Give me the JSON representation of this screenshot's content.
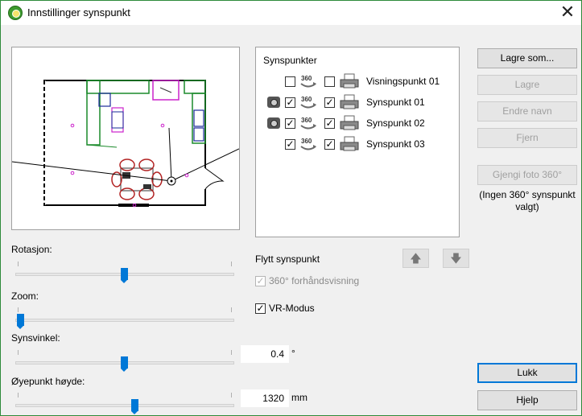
{
  "window": {
    "title": "Innstillinger synspunkt"
  },
  "viewpoints": {
    "header": "Synspunkter",
    "items": [
      {
        "label": "Visningspunkt 01",
        "camera": false,
        "check360": false,
        "checkVisible": false
      },
      {
        "label": "Synspunkt 01",
        "camera": true,
        "check360": true,
        "checkVisible": true
      },
      {
        "label": "Synspunkt 02",
        "camera": true,
        "check360": true,
        "checkVisible": true
      },
      {
        "label": "Synspunkt 03",
        "camera": false,
        "check360": true,
        "checkVisible": true
      }
    ]
  },
  "buttons": {
    "save_as": "Lagre som...",
    "save": "Lagre",
    "rename": "Endre navn",
    "remove": "Fjern",
    "render360": "Gjengi foto 360°",
    "close": "Lukk",
    "help": "Hjelp"
  },
  "render_note": "(Ingen 360° synspunkt valgt)",
  "move": {
    "label": "Flytt synspunkt",
    "preview360": "360° forhåndsvisning",
    "preview360_checked": true,
    "vr_mode": "VR-Modus",
    "vr_mode_checked": true
  },
  "sliders": {
    "rotation": {
      "label": "Rotasjon:",
      "level": 0.5
    },
    "zoom": {
      "label": "Zoom:",
      "level": 0.0
    },
    "view_angle": {
      "label": "Synsvinkel:",
      "level": 0.5,
      "value": "0.4",
      "unit": "°"
    },
    "eye_height": {
      "label": "Øyepunkt høyde:",
      "level": 0.55,
      "value": "1320",
      "unit": "mm"
    }
  },
  "icons": {
    "app": "viewpoint-app-icon",
    "close": "close-icon",
    "camera": "camera-icon",
    "pano": "360-icon",
    "printer": "printer-icon",
    "up": "arrow-up-icon",
    "down": "arrow-down-icon"
  }
}
